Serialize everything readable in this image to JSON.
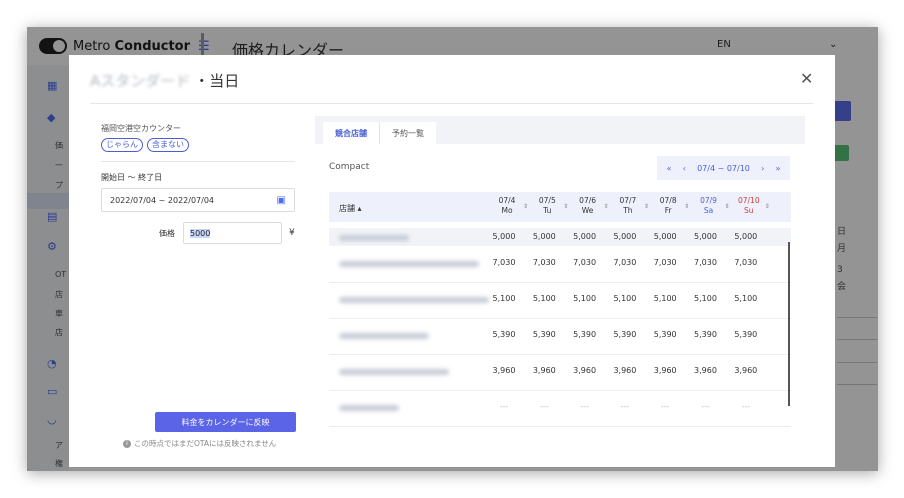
{
  "app": {
    "brand_prefix": "Metro",
    "brand_bold": "Conductor",
    "page_title": "価格カレンダー",
    "language": "EN",
    "sidebar_items": [
      "価",
      "一",
      "プ",
      "OT",
      "店",
      "車",
      "店",
      "ア",
      "権"
    ],
    "right_texts": [
      "日",
      "月",
      "3",
      "会"
    ]
  },
  "modal": {
    "title_blurred": "Aスタンダード",
    "title_suffix": "・当日",
    "close_label": "✕",
    "counter_name": "福岡空港空カウンター",
    "chips": [
      "じゃらん",
      "含まない"
    ],
    "date_label": "開始日 ～ 終了日",
    "date_range": "2022/07/04 ~ 2022/07/04",
    "price_label": "価格",
    "price_value": "5000",
    "currency": "¥",
    "apply_button": "料金をカレンダーに反映",
    "apply_note": "この時点ではまだOTAには反映されません"
  },
  "panel": {
    "tabs": [
      {
        "label": "競合店舗",
        "active": true
      },
      {
        "label": "予約一覧",
        "active": false
      }
    ],
    "view_mode": "Compact",
    "pager": {
      "first": "«",
      "prev": "‹",
      "range": "07/4 ~ 07/10",
      "next": "›",
      "last": "»"
    },
    "store_header": "店舗 ▴",
    "days": [
      {
        "date": "07/4",
        "dow": "Mo",
        "kind": "weekday"
      },
      {
        "date": "07/5",
        "dow": "Tu",
        "kind": "weekday"
      },
      {
        "date": "07/6",
        "dow": "We",
        "kind": "weekday"
      },
      {
        "date": "07/7",
        "dow": "Th",
        "kind": "weekday"
      },
      {
        "date": "07/8",
        "dow": "Fr",
        "kind": "weekday"
      },
      {
        "date": "07/9",
        "dow": "Sa",
        "kind": "sat"
      },
      {
        "date": "07/10",
        "dow": "Su",
        "kind": "sun"
      }
    ],
    "rows": [
      [
        "5,000",
        "5,000",
        "5,000",
        "5,000",
        "5,000",
        "5,000",
        "5,000"
      ],
      [
        "7,030",
        "7,030",
        "7,030",
        "7,030",
        "7,030",
        "7,030",
        "7,030"
      ],
      [
        "5,100",
        "5,100",
        "5,100",
        "5,100",
        "5,100",
        "5,100",
        "5,100"
      ],
      [
        "5,390",
        "5,390",
        "5,390",
        "5,390",
        "5,390",
        "5,390",
        "5,390"
      ],
      [
        "3,960",
        "3,960",
        "3,960",
        "3,960",
        "3,960",
        "3,960",
        "3,960"
      ],
      [
        "---",
        "---",
        "---",
        "---",
        "---",
        "---",
        "---"
      ]
    ]
  }
}
